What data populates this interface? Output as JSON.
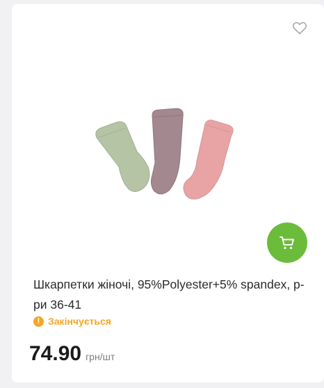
{
  "product": {
    "title": "Шкарпетки жіночі, 95%Polyester+5% spandex, р-ри 36-41",
    "status": "Закінчується",
    "price": "74.90",
    "unit": "грн/шт"
  },
  "icons": {
    "favorite": "heart-outline-icon",
    "cart": "cart-icon",
    "status": "exclamation-icon"
  },
  "colors": {
    "cart_button": "#6cbc3b",
    "status": "#f5a623"
  }
}
